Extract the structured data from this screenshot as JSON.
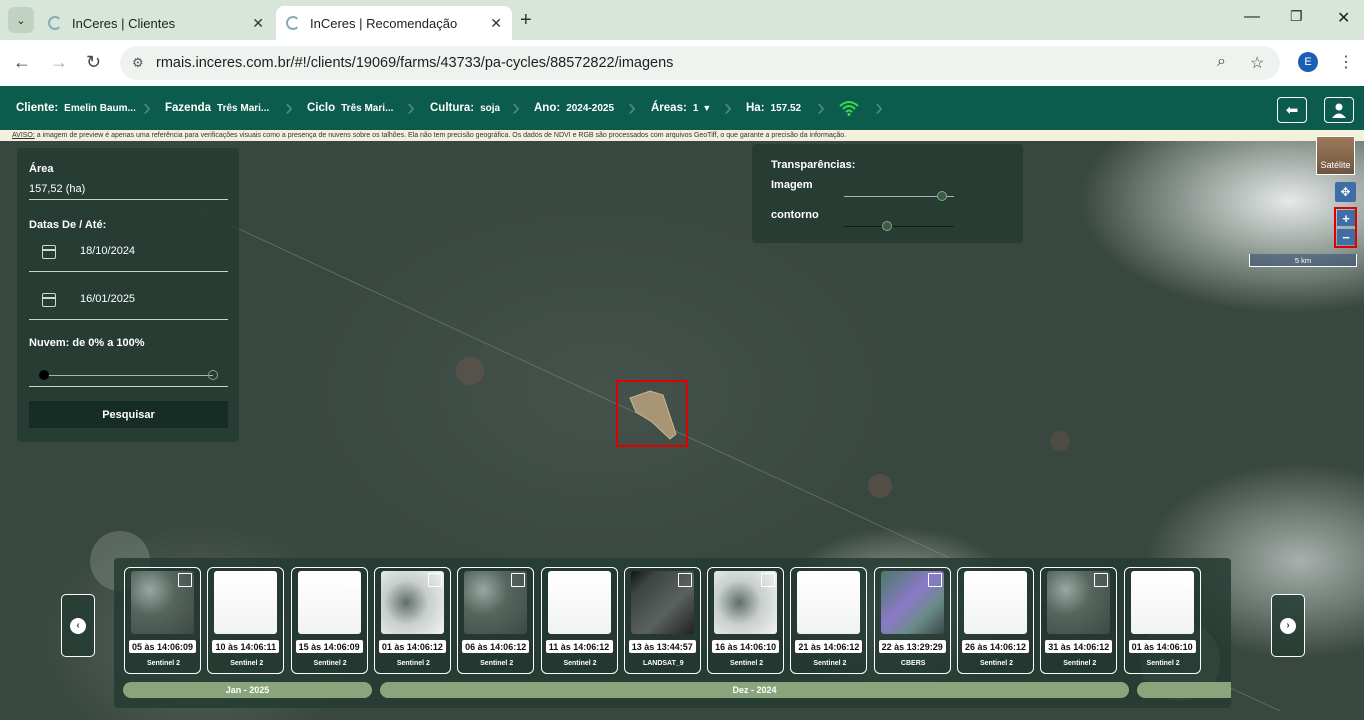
{
  "browser": {
    "tabs": [
      {
        "title": "InCeres | Clientes"
      },
      {
        "title": "InCeres | Recomendação"
      }
    ],
    "url": "rmais.inceres.com.br/#!/clients/19069/farms/43733/pa-cycles/88572822/imagens",
    "profile_initial": "E"
  },
  "header": {
    "cliente_label": "Cliente:",
    "cliente_value": "Emelin Baum...",
    "fazenda_label": "Fazenda",
    "fazenda_value": "Três Mari...",
    "ciclo_label": "Ciclo",
    "ciclo_value": "Três Mari...",
    "cultura_label": "Cultura:",
    "cultura_value": "soja",
    "ano_label": "Ano:",
    "ano_value": "2024-2025",
    "areas_label": "Áreas:",
    "areas_value": "1",
    "ha_label": "Ha:",
    "ha_value": "157.52"
  },
  "notice": {
    "prefix": "AVISO:",
    "text": " a imagem de preview é apenas uma referência para verificações visuais como a presença de nuvens sobre os talhões. Ela não tem precisão geográfica. Os dados de NDVI e RGB são processados com arquivos GeoTiff, o que garante a precisão da informação."
  },
  "sidebar": {
    "area_label": "Área",
    "area_value": "157,52 (ha)",
    "dates_label": "Datas De / Até:",
    "date_from": "18/10/2024",
    "date_to": "16/01/2025",
    "cloud_label": "Nuvem: de 0% a 100%",
    "cloud_min": 0,
    "cloud_max": 100,
    "search_label": "Pesquisar"
  },
  "transparency": {
    "title": "Transparências:",
    "image_label": "Imagem",
    "contour_label": "contorno"
  },
  "map": {
    "layer_label": "Satélite",
    "zoom_in": "+",
    "zoom_out": "−",
    "scale_label": "5 km"
  },
  "timeline": {
    "items": [
      {
        "date": "05 às 14:06:09",
        "source": "Sentinel 2",
        "tone": "forest"
      },
      {
        "date": "10 às 14:06:11",
        "source": "Sentinel 2",
        "tone": "white"
      },
      {
        "date": "15 às 14:06:09",
        "source": "Sentinel 2",
        "tone": "white"
      },
      {
        "date": "01 às 14:06:12",
        "source": "Sentinel 2",
        "tone": "mixed"
      },
      {
        "date": "06 às 14:06:12",
        "source": "Sentinel 2",
        "tone": "forest"
      },
      {
        "date": "11 às 14:06:12",
        "source": "Sentinel 2",
        "tone": "white"
      },
      {
        "date": "13 às 13:44:57",
        "source": "LANDSAT_9",
        "tone": "dark"
      },
      {
        "date": "16 às 14:06:10",
        "source": "Sentinel 2",
        "tone": "mixed"
      },
      {
        "date": "21 às 14:06:12",
        "source": "Sentinel 2",
        "tone": "white"
      },
      {
        "date": "22 às 13:29:29",
        "source": "CBERS",
        "tone": "purple"
      },
      {
        "date": "26 às 14:06:12",
        "source": "Sentinel 2",
        "tone": "white"
      },
      {
        "date": "31 às 14:06:12",
        "source": "Sentinel 2",
        "tone": "forest"
      },
      {
        "date": "01 às 14:06:10",
        "source": "Sentinel 2",
        "tone": "white"
      }
    ],
    "months": [
      {
        "label": "Jan - 2025"
      },
      {
        "label": "Dez - 2024"
      },
      {
        "label": ""
      }
    ]
  }
}
